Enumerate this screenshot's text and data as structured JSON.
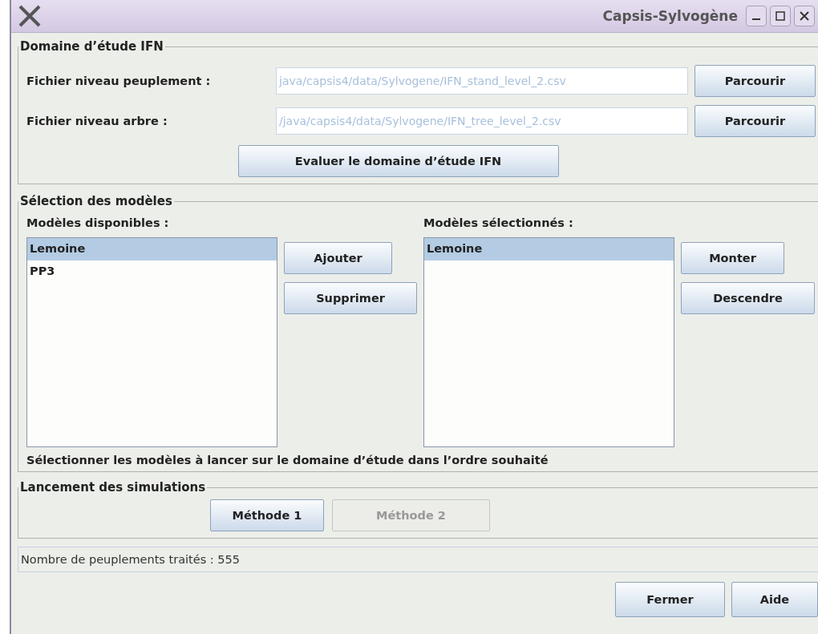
{
  "window": {
    "title": "Capsis-Sylvogène"
  },
  "domain": {
    "legend": "Domaine d’étude IFN",
    "files": [
      {
        "label": "Fichier niveau peuplement :",
        "value": "java/capsis4/data/Sylvogene/IFN_stand_level_2.csv",
        "disabled": true,
        "button": "Parcourir"
      },
      {
        "label": "Fichier niveau arbre :",
        "value": "/java/capsis4/data/Sylvogene/IFN_tree_level_2.csv",
        "disabled": true,
        "button": "Parcourir"
      }
    ],
    "action": "Evaluer le domaine d’étude IFN"
  },
  "models": {
    "legend": "Sélection des modèles",
    "available": {
      "label": "Modèles disponibles :",
      "items": [
        {
          "text": "Lemoine",
          "selected": true
        },
        {
          "text": "PP3",
          "selected": false
        }
      ],
      "buttons": [
        "Ajouter",
        "Supprimer"
      ]
    },
    "chosen": {
      "label": "Modèles sélectionnés :",
      "items": [
        {
          "text": "Lemoine",
          "selected": true
        }
      ],
      "buttons": [
        "Monter",
        "Descendre"
      ]
    },
    "note": "Sélectionner les modèles à lancer sur le domaine d’étude dans l’ordre souhaité"
  },
  "launch": {
    "legend": "Lancement des simulations",
    "buttons": [
      {
        "label": "Méthode 1",
        "disabled": false
      },
      {
        "label": "Méthode 2",
        "disabled": true
      }
    ]
  },
  "status_bar": "Nombre de peuplements traités : 555",
  "footer_buttons": [
    "Fermer",
    "Aide"
  ]
}
